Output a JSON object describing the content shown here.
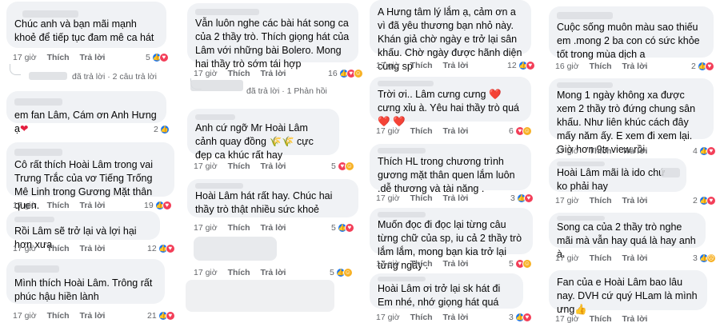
{
  "labels": {
    "like": "Thích",
    "reply": "Trả lời",
    "time": "17 giờ"
  },
  "col1": {
    "c1": {
      "text": "Chúc anh và bạn mãi mạnh khoẻ để tiếp tục đam mê ca hát",
      "time": "17 giờ",
      "count": "5"
    },
    "thread": {
      "replied": "đã trả lời",
      "sep": "·",
      "replies": "2 câu trả lời"
    },
    "c2": {
      "text": "em fan Lâm, Cám ơn Anh Hưng ạ",
      "time": "17 giờ",
      "count": "2"
    },
    "c3": {
      "text": "Cô rất thích Hoài Lâm trong vai Trưng Trắc của vơ Tiếng Trống Mê Linh trong Gương Mặt thân quen.",
      "time": "17 giờ",
      "count": "19"
    },
    "c4": {
      "text": "Rồi Lâm sẽ trở lại và lợi hại hơn xưa",
      "time": "17 giờ",
      "count": "12"
    },
    "c5": {
      "text": "Mình thích Hoài Lâm. Trông rất phúc hậu hiền lành",
      "time": "17 giờ",
      "count": "21"
    }
  },
  "col2": {
    "c1": {
      "text": "Vẫn luôn nghe các bài hát song ca của 2 thầy trò. Thích giọng hát của Lâm với những bài Bolero. Mong hai thầy trò sớm tái hợp",
      "time": "17 giờ",
      "count": "16"
    },
    "thread": {
      "replied": "đã trả lời",
      "sep": "·",
      "replies": "1 Phản hồi"
    },
    "c2": {
      "text": "Anh cứ ngỡ Mr Hoài Lâm cảnh quay đồng 🌾🌾 cực đẹp ca khúc rất hay",
      "time": "17 giờ",
      "count": "5"
    },
    "c3": {
      "text": "Hoài Lâm hát rất hay. Chúc hai thầy trò thật nhiều sức khoẻ",
      "time": "17 giờ",
      "count": "5"
    },
    "c4": {
      "time": "17 giờ",
      "count": "5"
    }
  },
  "col3": {
    "c1": {
      "text": "A Hưng tâm lý lắm ạ, cảm ơn a vì đã yêu thương bạn nhỏ này. Khán giả chờ ngày e trở lại sân khấu. Chờ ngày được hãnh diện cùng sp",
      "time": "17 giờ",
      "count": "12"
    },
    "c2": {
      "text": "Trời ơi.. Lâm cưng cưng ❤️ cưng xỉu à. Yêu hai thầy trò quá ❤️ ❤️",
      "time": "17 giờ",
      "count": "6"
    },
    "c3": {
      "text": "Thích HL trong chương trình gương mặt thân quen lắm luôn .dễ thương và tài năng .",
      "time": "17 giờ",
      "count": "3"
    },
    "c4": {
      "text": "Muốn đọc đi đọc lại từng câu từng chữ của sp, iu cả 2 thầy trò lắm lắm, mong bạn kia trở lại từng ngày .",
      "time": "17 giờ",
      "count": "5"
    },
    "c5": {
      "text": "Hoài Lâm ơi trở lại sk hát đi Em nhé, nhớ giọng hát quá",
      "time": "17 giờ",
      "count": "3"
    }
  },
  "col4": {
    "c1": {
      "text": "Cuộc sống muôn màu sao thiếu em .mong 2 ba con có sức khỏe tốt trong mùa dịch a",
      "time": "16 giờ",
      "count": "2"
    },
    "c2": {
      "text": "Mong 1 ngày không xa được xem 2 thầy trò đứng chung sân khấu. Như liên khúc cách đây mấy năm ấy. E xem đi xem lại. Giờ hơn 9tr view rồi.",
      "time": "17 giờ",
      "count": "4"
    },
    "c3": {
      "text": "Hoài Lâm mãi là ido chứ ko phải hay",
      "time": "17 giờ",
      "count": "2"
    },
    "c4": {
      "text": "Song ca của 2 thầy trò nghe mãi mà vẫn hay quá là hay anh à.",
      "time": "17 giờ",
      "count": "3"
    },
    "c5": {
      "text": "Fan của e Hoài Lâm bao lâu nay. DVH cứ quý HLam là mình ưng👍",
      "time": "17 giờ"
    }
  }
}
